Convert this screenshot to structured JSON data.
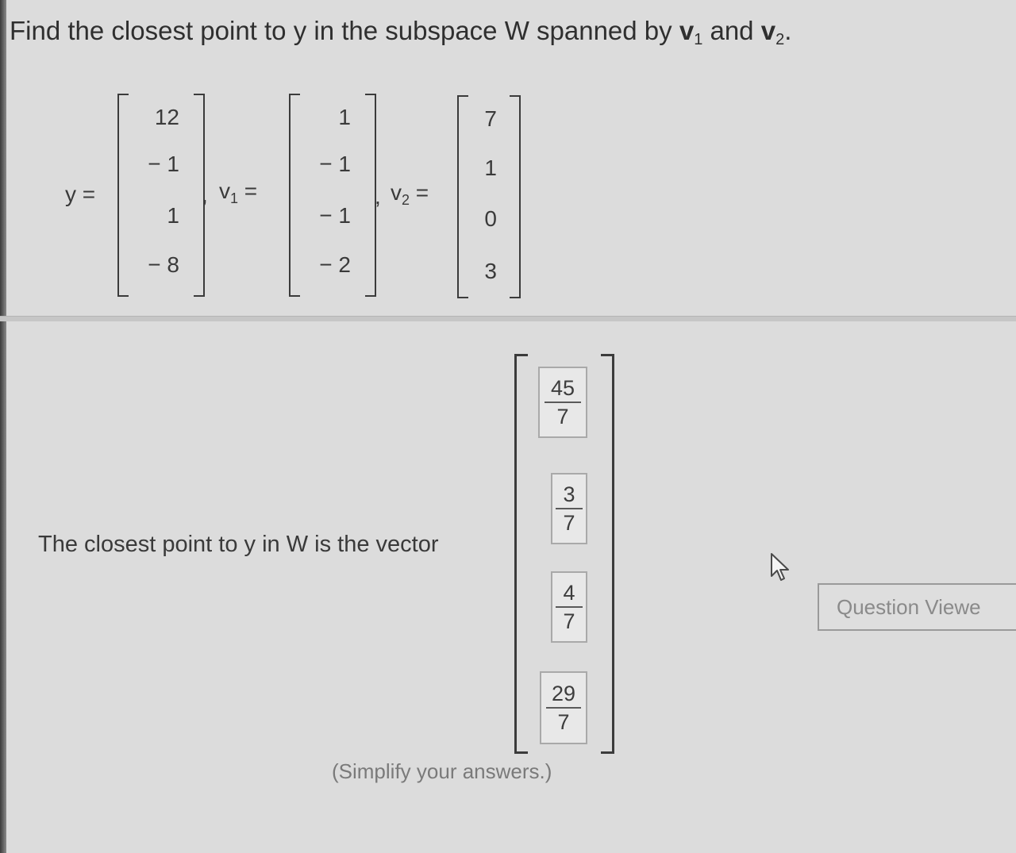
{
  "question": {
    "prefix": "Find the closest point to y in the subspace W spanned by ",
    "v1": "v",
    "v1_sub": "1",
    "and": " and ",
    "v2": "v",
    "v2_sub": "2",
    "end": "."
  },
  "vectors": {
    "y": {
      "label": "y =",
      "entries": [
        "12",
        "− 1",
        "1",
        "− 8"
      ]
    },
    "v1": {
      "label": "v",
      "label_sub": "1",
      "eq": " =",
      "entries": [
        "1",
        "− 1",
        "− 1",
        "− 2"
      ]
    },
    "v2": {
      "label": "v",
      "label_sub": "2",
      "eq": " =",
      "entries": [
        "7",
        "1",
        "0",
        "3"
      ]
    },
    "separator": ","
  },
  "answer": {
    "sentence": "The closest point to y in W is the vector",
    "entries": [
      {
        "num": "45",
        "den": "7"
      },
      {
        "num": "3",
        "den": "7"
      },
      {
        "num": "4",
        "den": "7"
      },
      {
        "num": "29",
        "den": "7"
      }
    ],
    "hint": "(Simplify your answers.)"
  },
  "question_viewer": {
    "label": "Question Viewe"
  },
  "icons": {
    "cursor": "mouse-pointer-icon"
  }
}
